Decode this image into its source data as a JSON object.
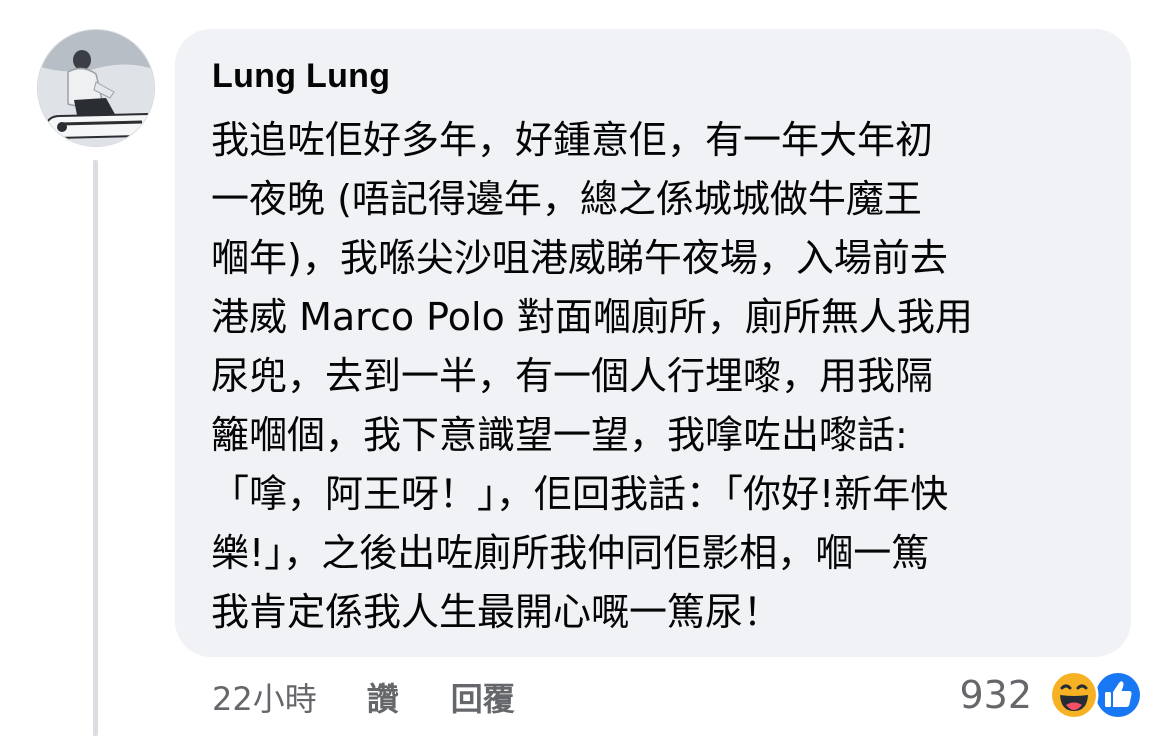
{
  "comment": {
    "author": "Lung Lung",
    "text_lines": [
      "我追咗佢好多年，好鍾意佢，有一年大年初",
      "一夜晚 (唔記得邊年，總之係城城做牛魔王",
      "嗰年)，我喺尖沙咀港威睇午夜場，入場前去",
      "港威 Marco Polo 對面嗰廁所，廁所無人我用",
      "尿兜，去到一半，有一個人行埋嚟，用我隔",
      "籬嗰個，我下意識望一望，我嗱咗出嚟話:",
      "「嗱，阿王呀！」，佢回我話：「你好!新年快",
      "樂!」，之後出咗廁所我仲同佢影相，嗰一篤",
      "我肯定係我人生最開心嘅一篤尿！"
    ],
    "timestamp": "22小時",
    "like_label": "讚",
    "reply_label": "回覆",
    "reaction_count": "932",
    "reaction_icons": [
      "haha-icon",
      "like-icon"
    ]
  },
  "colors": {
    "bubble": "#f0f2f5",
    "text": "#050505",
    "meta": "#65676b",
    "like_blue": "#1877f2",
    "haha_yellow": "#f7b125"
  }
}
